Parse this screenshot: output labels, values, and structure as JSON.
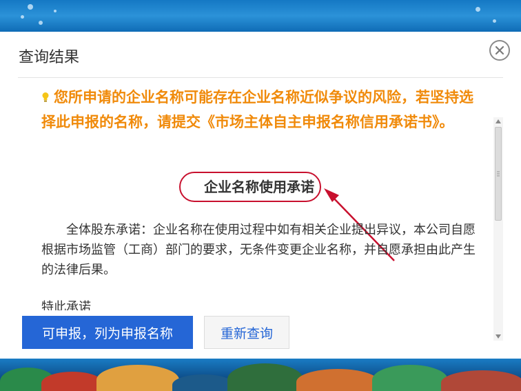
{
  "dialog": {
    "title": "查询结果",
    "close_icon": "close-icon"
  },
  "notice": {
    "icon": "lightbulb-icon",
    "text": "您所申请的企业名称可能存在企业名称近似争议的风险，若坚持选择此申报的名称，请提交《市场主体自主申报名称信用承诺书》。"
  },
  "pledge": {
    "title": "企业名称使用承诺",
    "body": "全体股东承诺：企业名称在使用过程中如有相关企业提出异议，本公司自愿根据市场监管（工商）部门的要求，无条件变更企业名称，并自愿承担由此产生的法律后果。",
    "next_heading_partial": "特此承诺"
  },
  "buttons": {
    "primary": "可申报，列为申报名称",
    "secondary": "重新查询"
  },
  "colors": {
    "notice": "#f08a0a",
    "primary_button": "#2566d6",
    "annotation": "#c8102e"
  }
}
